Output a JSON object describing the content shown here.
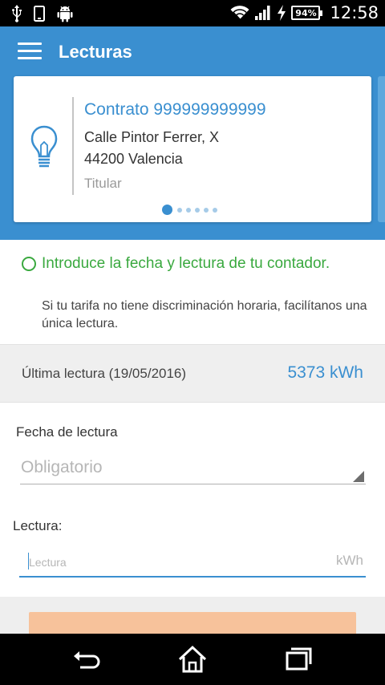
{
  "status_bar": {
    "left_icons": [
      "usb-icon",
      "phone-icon",
      "android-icon"
    ],
    "right_icons": [
      "wifi-icon",
      "signal-icon",
      "charging-icon"
    ],
    "battery": "94%",
    "time": "12:58"
  },
  "app_bar": {
    "menu_icon": "hamburger-menu-icon",
    "title": "Lecturas"
  },
  "contract_card": {
    "icon": "lightbulb-icon",
    "contract": "Contrato 999999999999",
    "address_line1": "Calle Pintor Ferrer, X",
    "address_line2": "44200 Valencia",
    "role": "Titular",
    "pager": {
      "total": 6,
      "active_index": 0
    }
  },
  "info": {
    "title": "Introduce la fecha y lectura de tu contador.",
    "subtitle": "Si tu tarifa no tiene discriminación horaria, facilítanos una única lectura."
  },
  "last_reading": {
    "label": "Última lectura (19/05/2016)",
    "value": "5373 kWh"
  },
  "form": {
    "date_label": "Fecha de lectura",
    "date_placeholder": "Obligatorio",
    "reading_label": "Lectura:",
    "reading_placeholder": "Lectura",
    "reading_value": "",
    "reading_unit": "kWh"
  },
  "colors": {
    "primary": "#3a8fd0",
    "accent_green": "#3aa93f",
    "button_disabled": "#f7c29b"
  },
  "nav_bar": {
    "icons": [
      "back-icon",
      "home-icon",
      "recent-apps-icon"
    ]
  }
}
